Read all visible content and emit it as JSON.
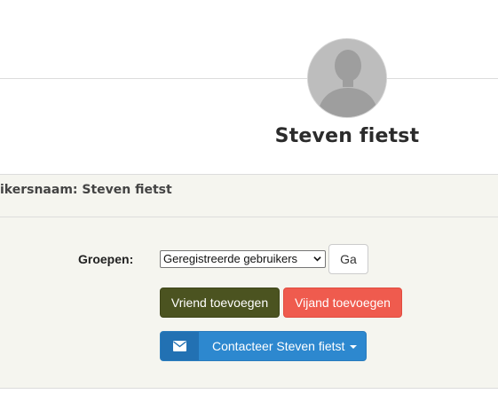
{
  "profile": {
    "name": "Steven fietst",
    "avatar_icon": "default-user-avatar-icon"
  },
  "username_row": {
    "text": "ikersnaam: Steven fietst"
  },
  "groups": {
    "label": "Groepen:",
    "selected": "Geregistreerde gebruikers",
    "go_label": "Ga"
  },
  "actions": {
    "add_friend": "Vriend toevoegen",
    "add_foe": "Vijand toevoegen",
    "contact": "Contacteer Steven fietst",
    "contact_icon": "envelope-icon"
  },
  "colors": {
    "friend_button": "#4b5320",
    "foe_button": "#ef5b4e",
    "contact_button": "#2d88cf",
    "contact_icon_cell": "#2271b3",
    "panel_background": "#f5f5ef"
  }
}
